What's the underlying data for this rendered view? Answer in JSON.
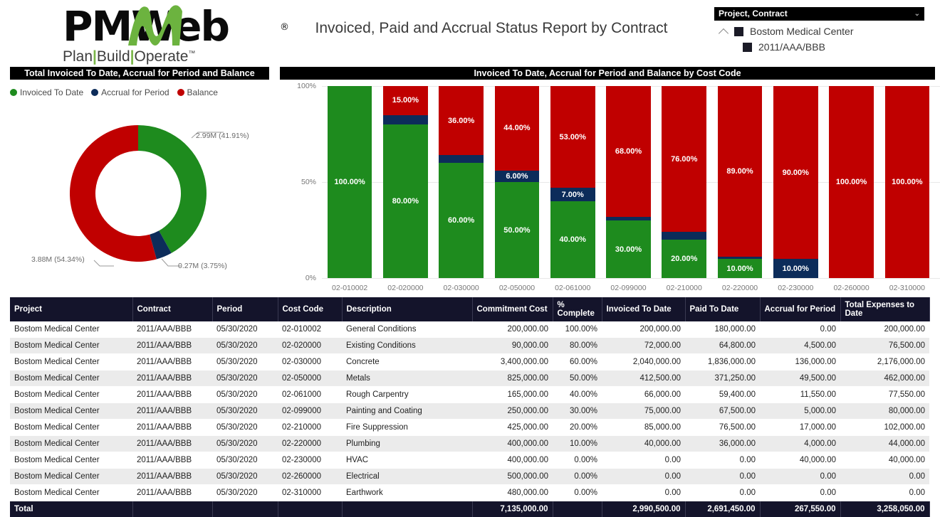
{
  "brand": {
    "logo_pm": "PM",
    "logo_w": "W",
    "logo_eb": "eb",
    "logo_reg": "®",
    "tagline_plan": "Plan",
    "tagline_build": "Build",
    "tagline_operate": "Operate",
    "tagline_tm": "™"
  },
  "header": {
    "report_title": "Invoiced, Paid and Accrual Status Report by Contract"
  },
  "slicer": {
    "title": "Project, Contract",
    "chevron": "⌄",
    "nodes": [
      {
        "label": "Bostom Medical Center",
        "level": 1
      },
      {
        "label": "2011/AAA/BBB",
        "level": 2
      }
    ]
  },
  "donut_panel": {
    "title": "Total Invoiced To Date, Accrual for Period and Balance",
    "legend": [
      {
        "label": "Invoiced To Date",
        "color": "#1E8B1E"
      },
      {
        "label": "Accrual for Period",
        "color": "#0C2C5A"
      },
      {
        "label": "Balance",
        "color": "#C00000"
      }
    ]
  },
  "bar_panel": {
    "title": "Invoiced To Date, Accrual for Period and Balance by Cost Code"
  },
  "colors": {
    "green": "#1E8B1E",
    "navy": "#0C2C5A",
    "red": "#C00000",
    "header_bar": "#000000",
    "table_header": "#14142B",
    "row_alt": "#EBEBEB"
  },
  "chart_data": [
    {
      "type": "pie",
      "title": "Total Invoiced To Date, Accrual for Period and Balance",
      "legend_position": "top-left",
      "labels": [
        "Invoiced To Date",
        "Accrual for Period",
        "Balance"
      ],
      "values": [
        2.99,
        0.27,
        3.88
      ],
      "percentages": [
        41.91,
        3.75,
        54.34
      ],
      "data_labels": [
        "2.99M (41.91%)",
        "0.27M (3.75%)",
        "3.88M (54.34%)"
      ],
      "colors": [
        "#1E8B1E",
        "#0C2C5A",
        "#C00000"
      ]
    },
    {
      "type": "bar",
      "subtype": "stacked-100",
      "title": "Invoiced To Date, Accrual for Period and Balance by Cost Code",
      "xlabel": "",
      "ylabel": "",
      "ylim": [
        0,
        100
      ],
      "yticks": [
        "0%",
        "50%",
        "100%"
      ],
      "grid": true,
      "categories": [
        "02-010002",
        "02-020000",
        "02-030000",
        "02-050000",
        "02-061000",
        "02-099000",
        "02-210000",
        "02-220000",
        "02-230000",
        "02-260000",
        "02-310000"
      ],
      "series": [
        {
          "name": "Invoiced To Date",
          "color": "#1E8B1E",
          "values": [
            100,
            80,
            60,
            50,
            40,
            30,
            20,
            10,
            0,
            0,
            0
          ]
        },
        {
          "name": "Accrual for Period",
          "color": "#0C2C5A",
          "values": [
            0,
            5,
            4,
            6,
            7,
            2,
            4,
            1,
            10,
            0,
            0
          ]
        },
        {
          "name": "Balance",
          "color": "#C00000",
          "values": [
            0,
            15,
            36,
            44,
            53,
            68,
            76,
            89,
            90,
            100,
            100
          ]
        }
      ],
      "data_labels": {
        "Invoiced To Date": [
          "100.00%",
          "80.00%",
          "60.00%",
          "50.00%",
          "40.00%",
          "30.00%",
          "20.00%",
          "10.00%",
          "",
          "",
          ""
        ],
        "Accrual for Period": [
          "",
          "",
          "",
          "6.00%",
          "7.00%",
          "",
          "",
          "",
          "10.00%",
          "",
          ""
        ],
        "Balance": [
          "",
          "15.00%",
          "36.00%",
          "44.00%",
          "53.00%",
          "68.00%",
          "76.00%",
          "89.00%",
          "90.00%",
          "100.00%",
          "100.00%"
        ]
      }
    }
  ],
  "table": {
    "columns": [
      {
        "label": "Project",
        "align": "left"
      },
      {
        "label": "Contract",
        "align": "left"
      },
      {
        "label": "Period",
        "align": "left"
      },
      {
        "label": "Cost Code",
        "align": "left"
      },
      {
        "label": "Description",
        "align": "left"
      },
      {
        "label": "Commitment Cost",
        "align": "right"
      },
      {
        "label": "% Complete",
        "align": "right"
      },
      {
        "label": "Invoiced To Date",
        "align": "right"
      },
      {
        "label": "Paid To Date",
        "align": "right"
      },
      {
        "label": "Accrual for Period",
        "align": "right"
      },
      {
        "label": "Total Expenses to Date",
        "align": "right"
      }
    ],
    "rows": [
      [
        "Bostom Medical Center",
        "2011/AAA/BBB",
        "05/30/2020",
        "02-010002",
        "General Conditions",
        "200,000.00",
        "100.00%",
        "200,000.00",
        "180,000.00",
        "0.00",
        "200,000.00"
      ],
      [
        "Bostom Medical Center",
        "2011/AAA/BBB",
        "05/30/2020",
        "02-020000",
        "Existing Conditions",
        "90,000.00",
        "80.00%",
        "72,000.00",
        "64,800.00",
        "4,500.00",
        "76,500.00"
      ],
      [
        "Bostom Medical Center",
        "2011/AAA/BBB",
        "05/30/2020",
        "02-030000",
        "Concrete",
        "3,400,000.00",
        "60.00%",
        "2,040,000.00",
        "1,836,000.00",
        "136,000.00",
        "2,176,000.00"
      ],
      [
        "Bostom Medical Center",
        "2011/AAA/BBB",
        "05/30/2020",
        "02-050000",
        "Metals",
        "825,000.00",
        "50.00%",
        "412,500.00",
        "371,250.00",
        "49,500.00",
        "462,000.00"
      ],
      [
        "Bostom Medical Center",
        "2011/AAA/BBB",
        "05/30/2020",
        "02-061000",
        "Rough Carpentry",
        "165,000.00",
        "40.00%",
        "66,000.00",
        "59,400.00",
        "11,550.00",
        "77,550.00"
      ],
      [
        "Bostom Medical Center",
        "2011/AAA/BBB",
        "05/30/2020",
        "02-099000",
        "Painting and Coating",
        "250,000.00",
        "30.00%",
        "75,000.00",
        "67,500.00",
        "5,000.00",
        "80,000.00"
      ],
      [
        "Bostom Medical Center",
        "2011/AAA/BBB",
        "05/30/2020",
        "02-210000",
        "Fire Suppression",
        "425,000.00",
        "20.00%",
        "85,000.00",
        "76,500.00",
        "17,000.00",
        "102,000.00"
      ],
      [
        "Bostom Medical Center",
        "2011/AAA/BBB",
        "05/30/2020",
        "02-220000",
        "Plumbing",
        "400,000.00",
        "10.00%",
        "40,000.00",
        "36,000.00",
        "4,000.00",
        "44,000.00"
      ],
      [
        "Bostom Medical Center",
        "2011/AAA/BBB",
        "05/30/2020",
        "02-230000",
        "HVAC",
        "400,000.00",
        "0.00%",
        "0.00",
        "0.00",
        "40,000.00",
        "40,000.00"
      ],
      [
        "Bostom Medical Center",
        "2011/AAA/BBB",
        "05/30/2020",
        "02-260000",
        "Electrical",
        "500,000.00",
        "0.00%",
        "0.00",
        "0.00",
        "0.00",
        "0.00"
      ],
      [
        "Bostom Medical Center",
        "2011/AAA/BBB",
        "05/30/2020",
        "02-310000",
        "Earthwork",
        "480,000.00",
        "0.00%",
        "0.00",
        "0.00",
        "0.00",
        "0.00"
      ]
    ],
    "total_row": [
      "Total",
      "",
      "",
      "",
      "",
      "7,135,000.00",
      "",
      "2,990,500.00",
      "2,691,450.00",
      "267,550.00",
      "3,258,050.00"
    ]
  }
}
